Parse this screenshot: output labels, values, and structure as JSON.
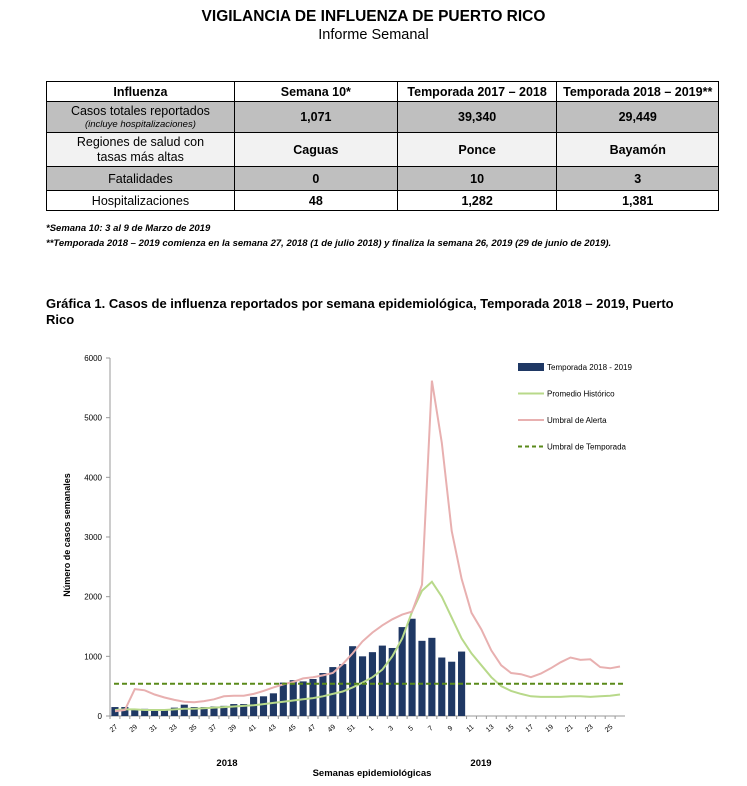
{
  "header": {
    "title": "VIGILANCIA DE INFLUENZA DE PUERTO RICO",
    "subtitle": "Informe Semanal"
  },
  "table": {
    "headers": [
      "Influenza",
      "Semana 10*",
      "Temporada 2017 – 2018",
      "Temporada 2018 – 2019**"
    ],
    "rows": [
      {
        "label": "Casos totales reportados",
        "note": "(incluye hospitalizaciones)",
        "values": [
          "1,071",
          "39,340",
          "29,449"
        ]
      },
      {
        "label": "Regiones de salud con",
        "label2": "tasas más altas",
        "values": [
          "Caguas",
          "Ponce",
          "Bayamón"
        ]
      },
      {
        "label": "Fatalidades",
        "values": [
          "0",
          "10",
          "3"
        ]
      },
      {
        "label": "Hospitalizaciones",
        "values": [
          "48",
          "1,282",
          "1,381"
        ]
      }
    ]
  },
  "footnotes": {
    "f1": "*Semana 10: 3 al 9 de Marzo de 2019",
    "f2": "**Temporada 2018 – 2019 comienza en la semana 27, 2018 (1 de julio 2018) y finaliza la semana 26, 2019 (29 de junio de 2019)."
  },
  "chart_title": "Gráfica 1. Casos de influenza reportados por semana epidemiológica, Temporada 2018 – 2019, Puerto Rico",
  "chart_data": {
    "type": "bar",
    "ylabel": "Número de casos semanales",
    "xlabel": "Semanas epidemiológicas",
    "year_labels": [
      "2018",
      "2019"
    ],
    "ylim": [
      0,
      6000
    ],
    "yticks": [
      0,
      1000,
      2000,
      3000,
      4000,
      5000,
      6000
    ],
    "categories": [
      "27",
      "28",
      "29",
      "30",
      "31",
      "32",
      "33",
      "34",
      "35",
      "36",
      "37",
      "38",
      "39",
      "40",
      "41",
      "42",
      "43",
      "44",
      "45",
      "46",
      "47",
      "48",
      "49",
      "50",
      "51",
      "52",
      "1",
      "2",
      "3",
      "4",
      "5",
      "6",
      "7",
      "8",
      "9",
      "10",
      "11",
      "12",
      "13",
      "14",
      "15",
      "16",
      "17",
      "18",
      "19",
      "20",
      "21",
      "22",
      "23",
      "24",
      "25",
      "26"
    ],
    "tick_labels": [
      "27",
      "29",
      "31",
      "33",
      "35",
      "37",
      "39",
      "41",
      "43",
      "45",
      "47",
      "49",
      "51",
      "1",
      "3",
      "5",
      "7",
      "9",
      "11",
      "13",
      "15",
      "17",
      "19",
      "21",
      "23",
      "25"
    ],
    "series": [
      {
        "name": "Temporada 2018 - 2019",
        "kind": "bar",
        "color": "#1f3864",
        "values": [
          150,
          150,
          110,
          120,
          110,
          100,
          140,
          190,
          150,
          150,
          160,
          170,
          200,
          200,
          320,
          330,
          380,
          560,
          600,
          580,
          620,
          720,
          820,
          870,
          1170,
          1000,
          1070,
          1180,
          1140,
          1490,
          1630,
          1260,
          1310,
          980,
          910,
          1080
        ]
      },
      {
        "name": "Promedio Histórico",
        "kind": "line",
        "color": "#b8d98a",
        "values": [
          100,
          110,
          110,
          100,
          100,
          100,
          110,
          120,
          120,
          130,
          140,
          150,
          160,
          170,
          180,
          200,
          220,
          240,
          260,
          280,
          300,
          330,
          370,
          410,
          480,
          560,
          650,
          780,
          1000,
          1300,
          1750,
          2100,
          2250,
          2000,
          1650,
          1300,
          1050,
          850,
          650,
          500,
          420,
          370,
          330,
          320,
          320,
          320,
          330,
          330,
          320,
          330,
          340,
          360
        ]
      },
      {
        "name": "Umbral de Alerta",
        "kind": "line",
        "color": "#e8b0b0",
        "values": [
          80,
          100,
          450,
          430,
          360,
          310,
          270,
          240,
          230,
          250,
          280,
          330,
          340,
          340,
          370,
          420,
          480,
          530,
          570,
          630,
          650,
          680,
          720,
          870,
          1050,
          1250,
          1400,
          1520,
          1620,
          1700,
          1750,
          2200,
          5620,
          4580,
          3100,
          2300,
          1730,
          1450,
          1100,
          850,
          720,
          700,
          650,
          710,
          800,
          900,
          980,
          940,
          950,
          820,
          800,
          830
        ]
      },
      {
        "name": "Umbral de Temporada",
        "kind": "dashed",
        "color": "#5a8a1a",
        "value": 540
      }
    ],
    "legend_position": "top-right"
  }
}
